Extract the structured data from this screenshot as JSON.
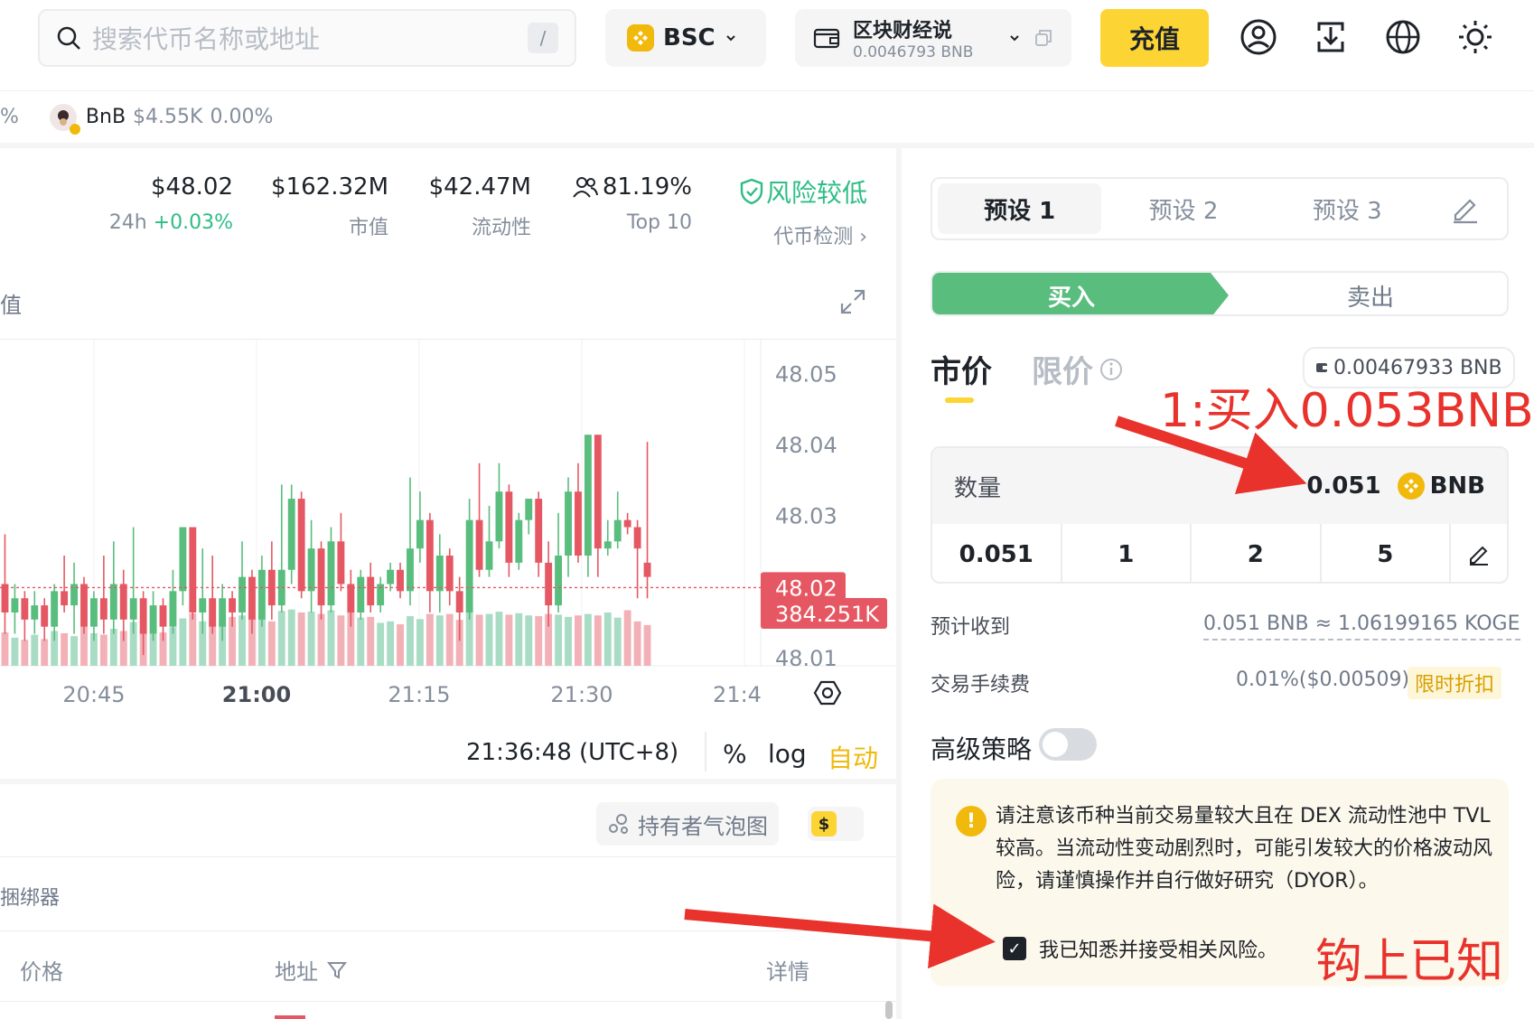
{
  "header": {
    "search_placeholder": "搜索代币名称或地址",
    "search_shortcut": "/",
    "chain": "BSC",
    "wallet_name": "区块财经说",
    "wallet_balance": "0.0046793 BNB",
    "deposit_label": "充值"
  },
  "ticker": {
    "prev_suffix": "%",
    "name": "BnB",
    "price": "$4.55K",
    "change": "0.00%"
  },
  "stats": {
    "price": "$48.02",
    "change_prefix": "24h",
    "change": "+0.03%",
    "market_cap": "$162.32M",
    "market_cap_label": "市值",
    "liquidity": "$42.47M",
    "liquidity_label": "流动性",
    "top10": "81.19%",
    "top10_label": "Top 10",
    "risk": "风险较低",
    "risk_link": "代币检测 ›"
  },
  "chart": {
    "title_fragment": "值",
    "price_label": "48.02",
    "volume_label": "384.251K",
    "time_readout": "21:36:48 (UTC+8)",
    "pct": "%",
    "log": "log",
    "auto": "自动"
  },
  "chart_data": {
    "type": "candlestick",
    "y_ticks": [
      "48.05",
      "48.04",
      "48.03",
      "48.02",
      "48.01"
    ],
    "x_ticks": [
      "20:45",
      "21:00",
      "21:15",
      "21:30",
      "21:4"
    ],
    "current_price": 48.02,
    "last_volume": "384.251K",
    "ylim": [
      48.009,
      48.055
    ],
    "candles": [
      {
        "o": 48.0205,
        "c": 48.0165,
        "h": 48.0275,
        "l": 48.0135,
        "up": false
      },
      {
        "o": 48.0165,
        "c": 48.0185,
        "h": 48.0205,
        "l": 48.0135,
        "up": true
      },
      {
        "o": 48.0185,
        "c": 48.0155,
        "h": 48.0195,
        "l": 48.0125,
        "up": false
      },
      {
        "o": 48.0155,
        "c": 48.0175,
        "h": 48.0195,
        "l": 48.0135,
        "up": true
      },
      {
        "o": 48.0175,
        "c": 48.0145,
        "h": 48.0185,
        "l": 48.0125,
        "up": false
      },
      {
        "o": 48.0145,
        "c": 48.0195,
        "h": 48.0205,
        "l": 48.0125,
        "up": true
      },
      {
        "o": 48.0195,
        "c": 48.0175,
        "h": 48.0245,
        "l": 48.0165,
        "up": false
      },
      {
        "o": 48.0175,
        "c": 48.0205,
        "h": 48.0235,
        "l": 48.0135,
        "up": true
      },
      {
        "o": 48.0205,
        "c": 48.0145,
        "h": 48.0215,
        "l": 48.0135,
        "up": false
      },
      {
        "o": 48.0145,
        "c": 48.0185,
        "h": 48.0195,
        "l": 48.0125,
        "up": true
      },
      {
        "o": 48.0185,
        "c": 48.0155,
        "h": 48.0245,
        "l": 48.0135,
        "up": false
      },
      {
        "o": 48.0155,
        "c": 48.0205,
        "h": 48.0265,
        "l": 48.0135,
        "up": true
      },
      {
        "o": 48.0205,
        "c": 48.0155,
        "h": 48.0225,
        "l": 48.0125,
        "up": false
      },
      {
        "o": 48.0155,
        "c": 48.0185,
        "h": 48.0285,
        "l": 48.0135,
        "up": true
      },
      {
        "o": 48.0185,
        "c": 48.0135,
        "h": 48.0195,
        "l": 48.0105,
        "up": false
      },
      {
        "o": 48.0135,
        "c": 48.0175,
        "h": 48.0195,
        "l": 48.0125,
        "up": true
      },
      {
        "o": 48.0175,
        "c": 48.0145,
        "h": 48.0185,
        "l": 48.0125,
        "up": false
      },
      {
        "o": 48.0145,
        "c": 48.0195,
        "h": 48.0225,
        "l": 48.0135,
        "up": true
      },
      {
        "o": 48.0195,
        "c": 48.0285,
        "h": 48.0285,
        "l": 48.0175,
        "up": true
      },
      {
        "o": 48.0285,
        "c": 48.0165,
        "h": 48.0285,
        "l": 48.0155,
        "up": false
      },
      {
        "o": 48.0165,
        "c": 48.0185,
        "h": 48.0255,
        "l": 48.0135,
        "up": true
      },
      {
        "o": 48.0185,
        "c": 48.0145,
        "h": 48.0245,
        "l": 48.0135,
        "up": false
      },
      {
        "o": 48.0145,
        "c": 48.0185,
        "h": 48.0205,
        "l": 48.0125,
        "up": true
      },
      {
        "o": 48.0185,
        "c": 48.0165,
        "h": 48.0195,
        "l": 48.0145,
        "up": false
      },
      {
        "o": 48.0165,
        "c": 48.0215,
        "h": 48.0265,
        "l": 48.0155,
        "up": true
      },
      {
        "o": 48.0215,
        "c": 48.0155,
        "h": 48.0225,
        "l": 48.0135,
        "up": false
      },
      {
        "o": 48.0155,
        "c": 48.0225,
        "h": 48.0245,
        "l": 48.0145,
        "up": true
      },
      {
        "o": 48.0225,
        "c": 48.0175,
        "h": 48.0265,
        "l": 48.0155,
        "up": false
      },
      {
        "o": 48.0175,
        "c": 48.0225,
        "h": 48.0345,
        "l": 48.0165,
        "up": true
      },
      {
        "o": 48.0225,
        "c": 48.0325,
        "h": 48.0345,
        "l": 48.0205,
        "up": true
      },
      {
        "o": 48.0325,
        "c": 48.0195,
        "h": 48.0335,
        "l": 48.0185,
        "up": false
      },
      {
        "o": 48.0195,
        "c": 48.0255,
        "h": 48.0295,
        "l": 48.0165,
        "up": true
      },
      {
        "o": 48.0255,
        "c": 48.0175,
        "h": 48.0265,
        "l": 48.0155,
        "up": false
      },
      {
        "o": 48.0175,
        "c": 48.0265,
        "h": 48.0285,
        "l": 48.0165,
        "up": true
      },
      {
        "o": 48.0265,
        "c": 48.0205,
        "h": 48.0305,
        "l": 48.0195,
        "up": false
      },
      {
        "o": 48.0205,
        "c": 48.0165,
        "h": 48.0225,
        "l": 48.0145,
        "up": false
      },
      {
        "o": 48.0165,
        "c": 48.0215,
        "h": 48.0225,
        "l": 48.0155,
        "up": true
      },
      {
        "o": 48.0215,
        "c": 48.0175,
        "h": 48.0235,
        "l": 48.0165,
        "up": false
      },
      {
        "o": 48.0175,
        "c": 48.0205,
        "h": 48.0215,
        "l": 48.0165,
        "up": true
      },
      {
        "o": 48.0205,
        "c": 48.0225,
        "h": 48.0235,
        "l": 48.0195,
        "up": true
      },
      {
        "o": 48.0225,
        "c": 48.0195,
        "h": 48.0235,
        "l": 48.0185,
        "up": false
      },
      {
        "o": 48.0195,
        "c": 48.0255,
        "h": 48.0355,
        "l": 48.0175,
        "up": true
      },
      {
        "o": 48.0255,
        "c": 48.0295,
        "h": 48.0335,
        "l": 48.0235,
        "up": true
      },
      {
        "o": 48.0295,
        "c": 48.0195,
        "h": 48.0305,
        "l": 48.0165,
        "up": false
      },
      {
        "o": 48.0195,
        "c": 48.0245,
        "h": 48.0275,
        "l": 48.0165,
        "up": true
      },
      {
        "o": 48.0245,
        "c": 48.0195,
        "h": 48.0255,
        "l": 48.0175,
        "up": false
      },
      {
        "o": 48.0195,
        "c": 48.0165,
        "h": 48.0215,
        "l": 48.0125,
        "up": false
      },
      {
        "o": 48.0165,
        "c": 48.0295,
        "h": 48.0325,
        "l": 48.0155,
        "up": true
      },
      {
        "o": 48.0295,
        "c": 48.0225,
        "h": 48.0375,
        "l": 48.0215,
        "up": false
      },
      {
        "o": 48.0225,
        "c": 48.0265,
        "h": 48.0315,
        "l": 48.0215,
        "up": true
      },
      {
        "o": 48.0265,
        "c": 48.0335,
        "h": 48.0375,
        "l": 48.0255,
        "up": true
      },
      {
        "o": 48.0335,
        "c": 48.0235,
        "h": 48.0345,
        "l": 48.0215,
        "up": false
      },
      {
        "o": 48.0235,
        "c": 48.0295,
        "h": 48.0305,
        "l": 48.0225,
        "up": true
      },
      {
        "o": 48.0295,
        "c": 48.0325,
        "h": 48.0325,
        "l": 48.0275,
        "up": true
      },
      {
        "o": 48.0325,
        "c": 48.0235,
        "h": 48.0335,
        "l": 48.0215,
        "up": false
      },
      {
        "o": 48.0235,
        "c": 48.0175,
        "h": 48.0265,
        "l": 48.0145,
        "up": false
      },
      {
        "o": 48.0175,
        "c": 48.0245,
        "h": 48.0305,
        "l": 48.0165,
        "up": true
      },
      {
        "o": 48.0245,
        "c": 48.0335,
        "h": 48.0355,
        "l": 48.0215,
        "up": true
      },
      {
        "o": 48.0335,
        "c": 48.0245,
        "h": 48.0375,
        "l": 48.0235,
        "up": false
      },
      {
        "o": 48.0245,
        "c": 48.0415,
        "h": 48.0415,
        "l": 48.0215,
        "up": true
      },
      {
        "o": 48.0415,
        "c": 48.0255,
        "h": 48.0415,
        "l": 48.0215,
        "up": false
      },
      {
        "o": 48.0255,
        "c": 48.0265,
        "h": 48.0295,
        "l": 48.0245,
        "up": true
      },
      {
        "o": 48.0265,
        "c": 48.0295,
        "h": 48.0335,
        "l": 48.0255,
        "up": true
      },
      {
        "o": 48.0295,
        "c": 48.0285,
        "h": 48.0305,
        "l": 48.0275,
        "up": false
      },
      {
        "o": 48.0285,
        "c": 48.0255,
        "h": 48.0295,
        "l": 48.0185,
        "up": false
      },
      {
        "o": 48.0235,
        "c": 48.0215,
        "h": 48.0405,
        "l": 48.0185,
        "up": false
      }
    ],
    "volumes": [
      0.45,
      0.38,
      0.35,
      0.42,
      0.36,
      0.47,
      0.44,
      0.4,
      0.53,
      0.44,
      0.42,
      0.5,
      0.47,
      0.59,
      0.5,
      0.43,
      0.45,
      0.52,
      0.64,
      0.71,
      0.6,
      0.64,
      0.59,
      0.66,
      0.68,
      0.63,
      0.65,
      0.6,
      0.74,
      0.76,
      0.72,
      0.73,
      0.7,
      0.75,
      0.68,
      0.72,
      0.65,
      0.66,
      0.58,
      0.6,
      0.56,
      0.67,
      0.63,
      0.7,
      0.68,
      0.7,
      0.62,
      0.72,
      0.69,
      0.7,
      0.73,
      0.69,
      0.71,
      0.68,
      0.67,
      0.7,
      0.69,
      0.66,
      0.68,
      0.7,
      0.68,
      0.72,
      0.65,
      0.75,
      0.6,
      0.55
    ]
  },
  "lower": {
    "bubble_label": "持有者气泡图",
    "dollar_symbol": "$",
    "bundler_fragment": "捆绑器",
    "col_price": "价格",
    "col_address": "地址",
    "col_detail": "详情"
  },
  "panel": {
    "presets": [
      "预设 1",
      "预设 2",
      "预设 3"
    ],
    "buy": "买入",
    "sell": "卖出",
    "market": "市价",
    "limit": "限价",
    "balance": "0.00467933 BNB",
    "qty_label": "数量",
    "qty_value": "0.051",
    "qty_unit": "BNB",
    "quick": [
      "0.051",
      "1",
      "2",
      "5"
    ],
    "est_label": "预计收到",
    "est_value": "0.051 BNB ≈ 1.06199165 KOGE",
    "fee_label": "交易手续费",
    "fee_value": "0.01%($0.00509)",
    "fee_promo": "限时折扣",
    "advanced": "高级策略",
    "warning": "请注意该币种当前交易量较大且在 DEX 流动性池中 TVL 较高。当流动性变动剧烈时，可能引发较大的价格波动风险，请谨慎操作并自行做好研究（DYOR）。",
    "ack": "我已知悉并接受相关风险。"
  },
  "annotations": {
    "a1": "1:买入0.053BNB",
    "a2": "钩上已知"
  },
  "colors": {
    "accent": "#fcd535",
    "up": "#58bd7d",
    "down": "#e55863",
    "annotation": "#e8322b"
  }
}
